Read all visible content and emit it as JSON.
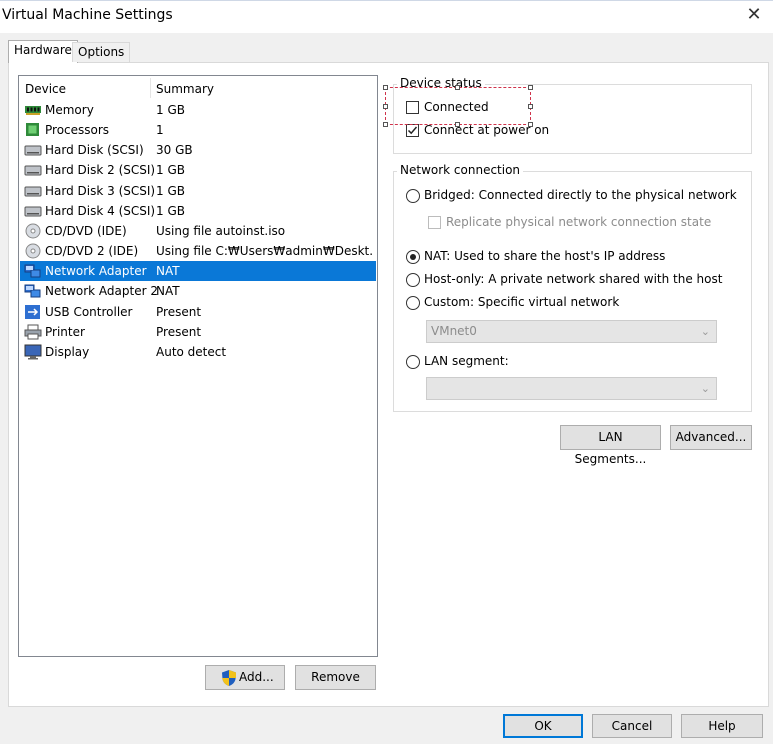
{
  "window": {
    "title": "Virtual Machine Settings",
    "close_glyph": "✕"
  },
  "tabs": [
    {
      "label": "Hardware",
      "active": true
    },
    {
      "label": "Options",
      "active": false
    }
  ],
  "devices": {
    "header": {
      "device": "Device",
      "summary": "Summary"
    },
    "rows": [
      {
        "name": "Memory",
        "summary": "1 GB",
        "icon": "memory-icon"
      },
      {
        "name": "Processors",
        "summary": "1",
        "icon": "processor-icon"
      },
      {
        "name": "Hard Disk (SCSI)",
        "summary": "30 GB",
        "icon": "hard-disk-icon"
      },
      {
        "name": "Hard Disk 2 (SCSI)",
        "summary": "1 GB",
        "icon": "hard-disk-icon"
      },
      {
        "name": "Hard Disk 3 (SCSI)",
        "summary": "1 GB",
        "icon": "hard-disk-icon"
      },
      {
        "name": "Hard Disk 4 (SCSI)",
        "summary": "1 GB",
        "icon": "hard-disk-icon"
      },
      {
        "name": "CD/DVD (IDE)",
        "summary": "Using file autoinst.iso",
        "icon": "cd-dvd-icon"
      },
      {
        "name": "CD/DVD 2 (IDE)",
        "summary": "Using file C:₩Users₩admin₩Deskt...",
        "icon": "cd-dvd-icon"
      },
      {
        "name": "Network Adapter",
        "summary": "NAT",
        "icon": "network-adapter-icon",
        "selected": true
      },
      {
        "name": "Network Adapter 2",
        "summary": "NAT",
        "icon": "network-adapter-icon"
      },
      {
        "name": "USB Controller",
        "summary": "Present",
        "icon": "usb-icon"
      },
      {
        "name": "Printer",
        "summary": "Present",
        "icon": "printer-icon"
      },
      {
        "name": "Display",
        "summary": "Auto detect",
        "icon": "display-icon"
      }
    ],
    "add_label": "Add...",
    "remove_label": "Remove"
  },
  "device_status": {
    "title": "Device status",
    "connected": {
      "label": "Connected",
      "checked": false
    },
    "connect_at_power_on": {
      "label": "Connect at power on",
      "checked": true
    }
  },
  "network": {
    "title": "Network connection",
    "bridged": {
      "label": "Bridged: Connected directly to the physical network",
      "selected": false
    },
    "replicate": {
      "label": "Replicate physical network connection state",
      "checked": false,
      "disabled": true
    },
    "nat": {
      "label": "NAT: Used to share the host's IP address",
      "selected": true
    },
    "host_only": {
      "label": "Host-only: A private network shared with the host",
      "selected": false
    },
    "custom": {
      "label": "Custom: Specific virtual network",
      "selected": false
    },
    "vmnet_value": "VMnet0",
    "lan_segment": {
      "label": "LAN segment:",
      "selected": false
    },
    "lan_segment_value": "",
    "lan_segments_button": "LAN Segments...",
    "advanced_button": "Advanced..."
  },
  "footer": {
    "ok": "OK",
    "cancel": "Cancel",
    "help": "Help"
  },
  "colors": {
    "selection": "#0a78d7",
    "focus_outline": "#d0334b",
    "default_button_border": "#0078d7"
  }
}
